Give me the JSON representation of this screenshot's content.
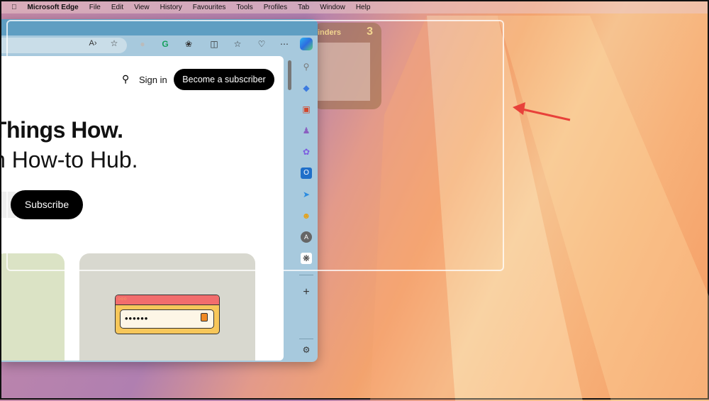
{
  "menubar": {
    "app": "Microsoft Edge",
    "items": [
      "File",
      "Edit",
      "View",
      "History",
      "Favourites",
      "Tools",
      "Profiles",
      "Tab",
      "Window",
      "Help"
    ]
  },
  "page": {
    "sign_in": "Sign in",
    "become_subscriber": "Become a subscriber",
    "headline": "Things How.",
    "subheadline": "n How-to Hub.",
    "subscribe": "Subscribe",
    "password_dots": "••••••"
  },
  "widget": {
    "title": "inders",
    "count": "3"
  },
  "colors": {
    "titlebar": "#5f9ec2",
    "toolbar": "#a7c9dd",
    "arrow": "#e8413a"
  }
}
